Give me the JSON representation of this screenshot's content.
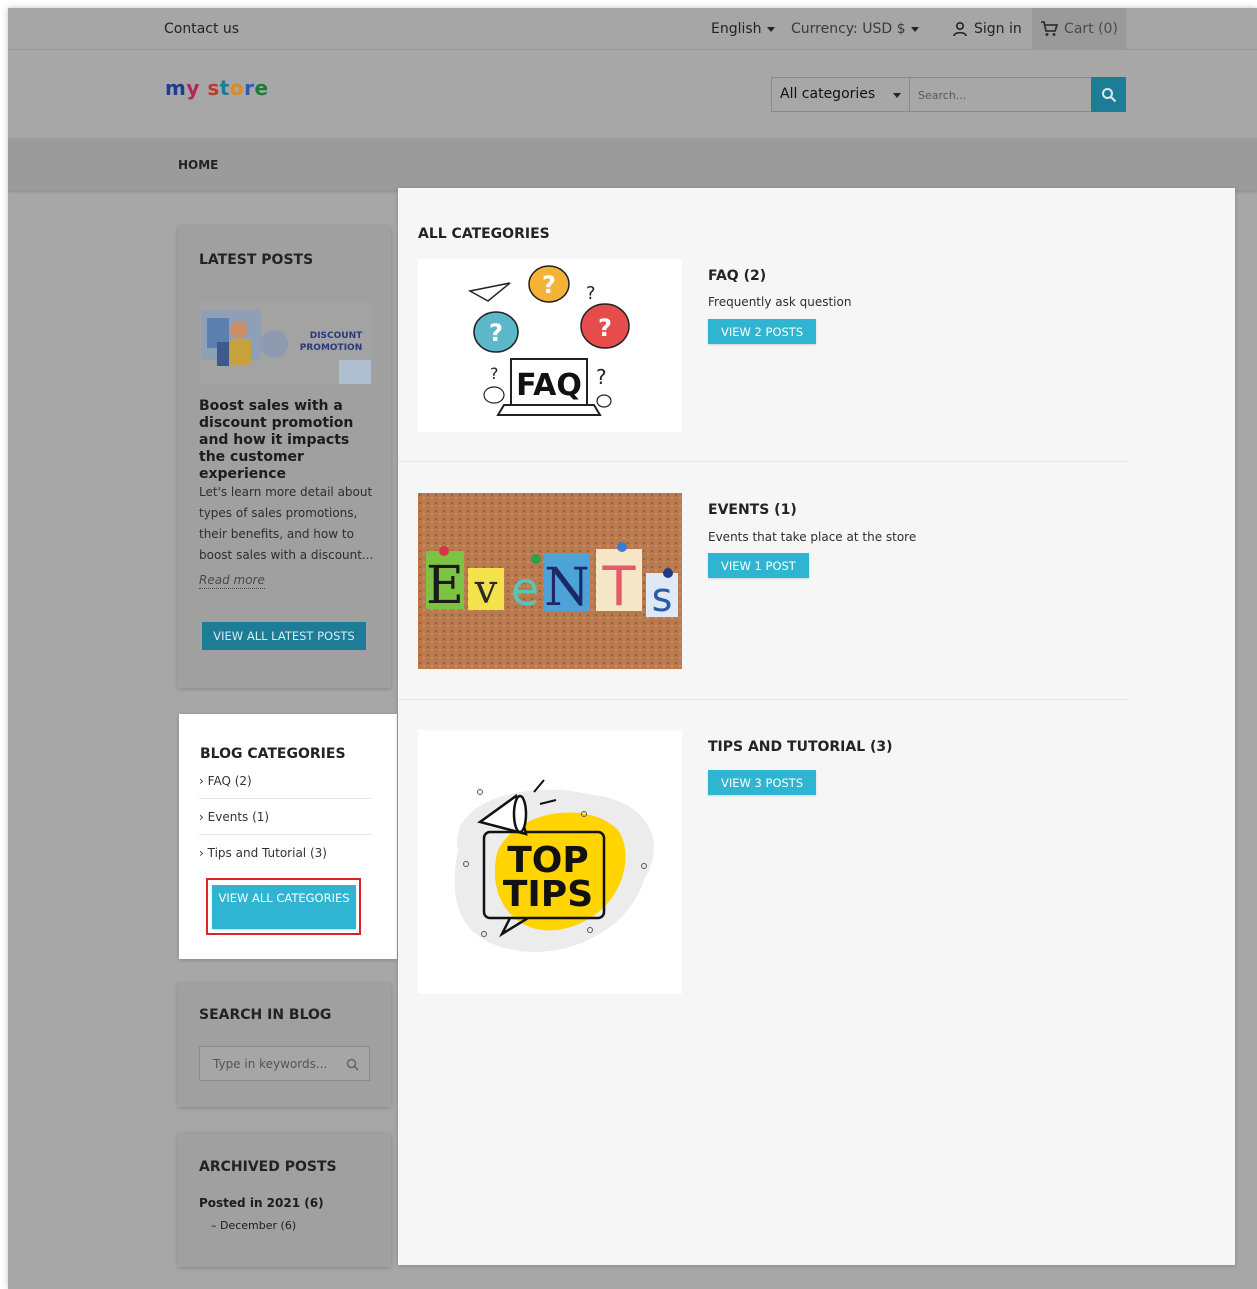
{
  "topbar": {
    "contact": "Contact us",
    "language": "English",
    "currency": "Currency: USD $",
    "signin": "Sign in",
    "cart": "Cart (0)"
  },
  "header": {
    "logo": {
      "m": "m",
      "y": "y",
      "s": "s",
      "t": "t",
      "o": "o",
      "r": "r",
      "e": "e"
    },
    "category_select": "All categories",
    "search_placeholder": "Search..."
  },
  "menu": {
    "home": "HOME"
  },
  "latest_posts": {
    "title": "LATEST POSTS",
    "thumb_text": {
      "line1": "DISCOUNT",
      "line2": "PROMOTION"
    },
    "post_title": "Boost sales with a discount promotion and how it impacts the customer experience",
    "excerpt": "Let's learn more detail about types of sales promotions, their benefits, and how to boost sales with a discount...",
    "read_more": "Read more",
    "view_all": "VIEW ALL LATEST POSTS"
  },
  "blog_categories": {
    "title": "BLOG CATEGORIES",
    "items": [
      {
        "label": "FAQ (2)"
      },
      {
        "label": "Events (1)"
      },
      {
        "label": "Tips and Tutorial (3)"
      }
    ],
    "view_all": "VIEW ALL CATEGORIES",
    "chevron": "›"
  },
  "search_blog": {
    "title": "SEARCH IN BLOG",
    "placeholder": "Type in keywords..."
  },
  "archived": {
    "title": "ARCHIVED POSTS",
    "year": "Posted in 2021 (6)",
    "month": "– December (6)"
  },
  "main": {
    "heading": "ALL CATEGORIES",
    "categories": [
      {
        "name": "FAQ (2)",
        "description": "Frequently ask question",
        "button": "VIEW 2 POSTS",
        "image_text": "FAQ"
      },
      {
        "name": "EVENTS (1)",
        "description": "Events that take place at the store",
        "button": "VIEW 1 POST",
        "image_text": {
          "E": "E",
          "v": "v",
          "e": "e",
          "N": "N",
          "T": "T",
          "s": "s"
        }
      },
      {
        "name": "TIPS AND TUTORIAL (3)",
        "description": "",
        "button": "VIEW 3 POSTS",
        "image_text": {
          "line1": "TOP",
          "line2": "TIPS"
        }
      }
    ]
  },
  "colors": {
    "accent": "#2fb5d2",
    "accent_dim": "#1d7c96",
    "highlight": "#d9232d"
  }
}
